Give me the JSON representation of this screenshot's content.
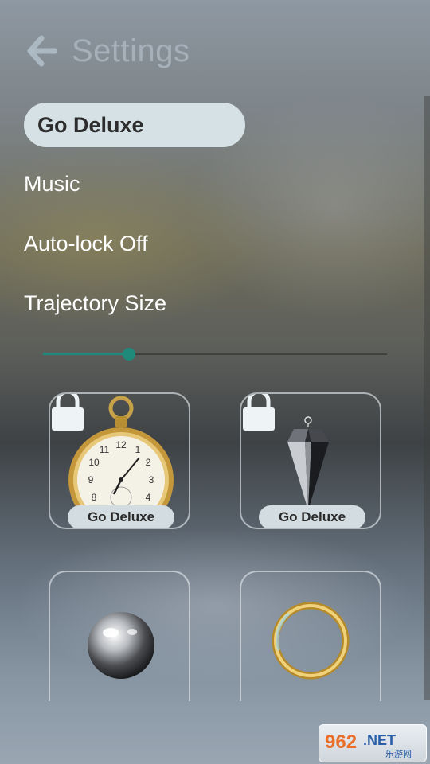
{
  "header": {
    "title": "Settings",
    "back_icon": "back-arrow-icon"
  },
  "menu": {
    "go_deluxe": "Go Deluxe",
    "music": "Music",
    "autolock": "Auto-lock Off",
    "trajectory_size": "Trajectory Size"
  },
  "slider": {
    "value_fraction": 0.25,
    "accent": "#1f8a7a"
  },
  "pendulums": [
    {
      "name": "pocket-watch",
      "locked": true,
      "tag": "Go Deluxe"
    },
    {
      "name": "crystal-pendulum",
      "locked": true,
      "tag": "Go Deluxe"
    },
    {
      "name": "metal-sphere",
      "locked": false
    },
    {
      "name": "gold-ring",
      "locked": false
    }
  ],
  "watermark": {
    "text": "962.NET",
    "sub": "乐游网"
  },
  "colors": {
    "pill_bg": "#d6e1e5",
    "accent": "#1f8a7a"
  }
}
